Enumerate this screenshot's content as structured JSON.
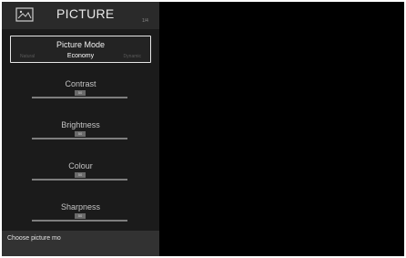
{
  "header": {
    "title": "PICTURE",
    "badge": "1/4",
    "icon": "picture-icon"
  },
  "picture_mode": {
    "label": "Picture Mode",
    "value": "Economy",
    "prev_option": "Natural",
    "next_option": "Dynamic"
  },
  "sliders": [
    {
      "label": "Contrast",
      "value": "50"
    },
    {
      "label": "Brightness",
      "value": "50"
    },
    {
      "label": "Colour",
      "value": "50"
    },
    {
      "label": "Sharpness",
      "value": "50"
    }
  ],
  "footer": {
    "hint": "Choose picture mo"
  },
  "colors": {
    "panel": "#1b1b1b",
    "header": "#2a2a2a",
    "footer": "#323232",
    "screen": "#000000",
    "focus_border": "#e6e6e6"
  }
}
